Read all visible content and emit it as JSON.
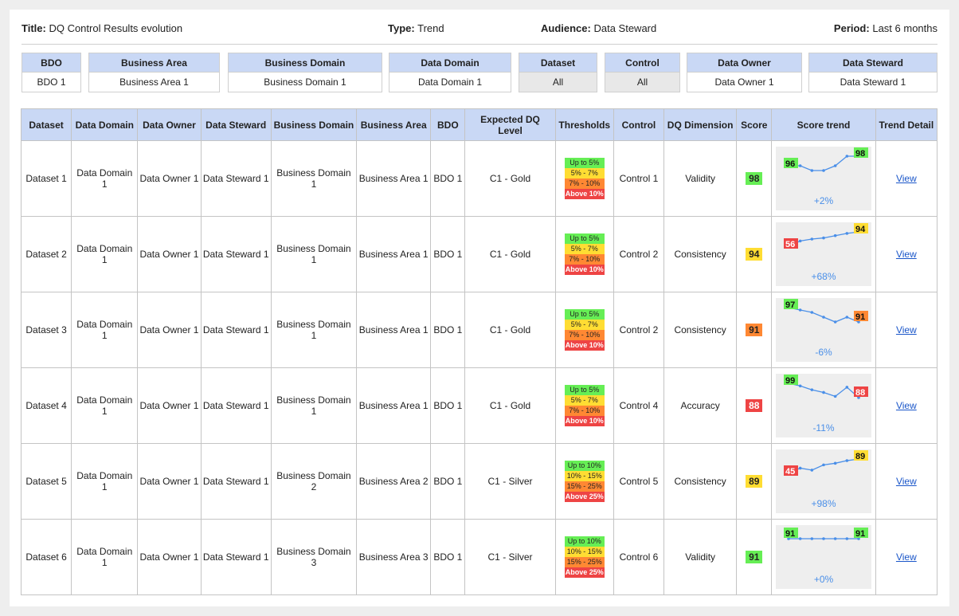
{
  "header": {
    "title_label": "Title:",
    "title_value": "DQ Control Results evolution",
    "type_label": "Type:",
    "type_value": "Trend",
    "audience_label": "Audience:",
    "audience_value": "Data Steward",
    "period_label": "Period:",
    "period_value": "Last 6 months"
  },
  "filters": [
    {
      "label": "BDO",
      "value": "BDO 1"
    },
    {
      "label": "Business Area",
      "value": "Business Area 1"
    },
    {
      "label": "Business Domain",
      "value": "Business Domain 1"
    },
    {
      "label": "Data Domain",
      "value": "Data Domain 1"
    },
    {
      "label": "Dataset",
      "value": "All"
    },
    {
      "label": "Control",
      "value": "All"
    },
    {
      "label": "Data Owner",
      "value": "Data Owner 1"
    },
    {
      "label": "Data Steward",
      "value": "Data Steward 1"
    }
  ],
  "columns": [
    "Dataset",
    "Data Domain",
    "Data Owner",
    "Data Steward",
    "Business Domain",
    "Business Area",
    "BDO",
    "Expected DQ Level",
    "Thresholds",
    "Control",
    "DQ Dimension",
    "Score",
    "Score trend",
    "Trend Detail"
  ],
  "colors": {
    "green": "#66ee55",
    "yellow": "#ffdd33",
    "orange": "#ff8833",
    "red": "#ee4444",
    "trend_line": "#4a8fe8",
    "link": "#1a56c9"
  },
  "rows": [
    {
      "dataset": "Dataset 1",
      "data_domain": "Data Domain 1",
      "data_owner": "Data Owner 1",
      "data_steward": "Data Steward 1",
      "business_domain": "Business Domain 1",
      "business_area": "Business Area 1",
      "bdo": "BDO 1",
      "level": "C1 - Gold",
      "thresholds": [
        "Up to 5%",
        "5% - 7%",
        "7% - 10%",
        "Above 10%"
      ],
      "control": "Control 1",
      "dimension": "Validity",
      "score": "98",
      "score_color": "green",
      "trend": [
        96,
        96,
        95,
        95,
        96,
        98,
        98
      ],
      "first_color": "green",
      "last_color": "green",
      "change": "+2%",
      "detail": "View"
    },
    {
      "dataset": "Dataset 2",
      "data_domain": "Data Domain 1",
      "data_owner": "Data Owner 1",
      "data_steward": "Data Steward 1",
      "business_domain": "Business Domain 1",
      "business_area": "Business Area 1",
      "bdo": "BDO 1",
      "level": "C1 - Gold",
      "thresholds": [
        "Up to 5%",
        "5% - 7%",
        "7% - 10%",
        "Above 10%"
      ],
      "control": "Control 2",
      "dimension": "Consistency",
      "score": "94",
      "score_color": "yellow",
      "trend": [
        56,
        70,
        75,
        78,
        84,
        90,
        94
      ],
      "first_color": "red",
      "last_color": "yellow",
      "change": "+68%",
      "detail": "View"
    },
    {
      "dataset": "Dataset 3",
      "data_domain": "Data Domain 1",
      "data_owner": "Data Owner 1",
      "data_steward": "Data Steward 1",
      "business_domain": "Business Domain 1",
      "business_area": "Business Area 1",
      "bdo": "BDO 1",
      "level": "C1 - Gold",
      "thresholds": [
        "Up to 5%",
        "5% - 7%",
        "7% - 10%",
        "Above 10%"
      ],
      "control": "Control 2",
      "dimension": "Consistency",
      "score": "91",
      "score_color": "orange",
      "trend": [
        97,
        96,
        95,
        93,
        91,
        93,
        91
      ],
      "first_color": "green",
      "last_color": "orange",
      "change": "-6%",
      "detail": "View"
    },
    {
      "dataset": "Dataset 4",
      "data_domain": "Data Domain 1",
      "data_owner": "Data Owner 1",
      "data_steward": "Data Steward 1",
      "business_domain": "Business Domain 1",
      "business_area": "Business Area 1",
      "bdo": "BDO 1",
      "level": "C1 - Gold",
      "thresholds": [
        "Up to 5%",
        "5% - 7%",
        "7% - 10%",
        "Above 10%"
      ],
      "control": "Control 4",
      "dimension": "Accuracy",
      "score": "88",
      "score_color": "red",
      "trend": [
        99,
        97,
        94,
        92,
        89,
        96,
        88
      ],
      "first_color": "green",
      "last_color": "red",
      "change": "-11%",
      "detail": "View"
    },
    {
      "dataset": "Dataset 5",
      "data_domain": "Data Domain 1",
      "data_owner": "Data Owner 1",
      "data_steward": "Data Steward 1",
      "business_domain": "Business Domain 2",
      "business_area": "Business Area 2",
      "bdo": "BDO 1",
      "level": "C1 - Silver",
      "thresholds": [
        "Up to 10%",
        "10% - 15%",
        "15% - 25%",
        "Above 25%"
      ],
      "control": "Control 5",
      "dimension": "Consistency",
      "score": "89",
      "score_color": "yellow",
      "trend": [
        45,
        61,
        55,
        71,
        76,
        84,
        89
      ],
      "first_color": "red",
      "last_color": "yellow",
      "change": "+98%",
      "detail": "View"
    },
    {
      "dataset": "Dataset 6",
      "data_domain": "Data Domain 1",
      "data_owner": "Data Owner 1",
      "data_steward": "Data Steward 1",
      "business_domain": "Business Domain 3",
      "business_area": "Business Area 3",
      "bdo": "BDO 1",
      "level": "C1 - Silver",
      "thresholds": [
        "Up to 10%",
        "10% - 15%",
        "15% - 25%",
        "Above 25%"
      ],
      "control": "Control 6",
      "dimension": "Validity",
      "score": "91",
      "score_color": "green",
      "trend": [
        91,
        91,
        91,
        91,
        91,
        91,
        91
      ],
      "first_color": "green",
      "last_color": "green",
      "change": "+0%",
      "detail": "View"
    }
  ]
}
